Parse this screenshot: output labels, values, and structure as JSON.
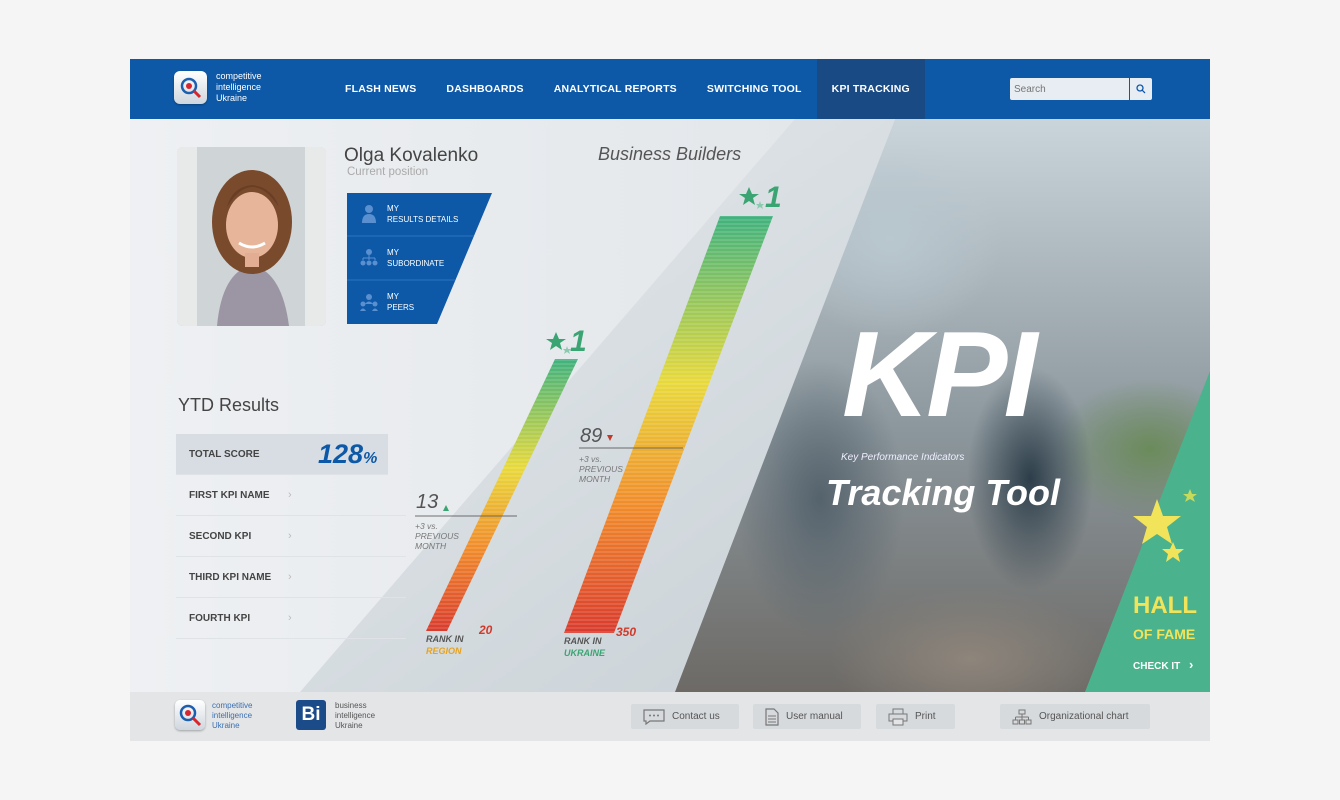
{
  "header": {
    "logo_lines": [
      "competitive",
      "intelligence",
      "Ukraine"
    ],
    "nav": [
      "FLASH NEWS",
      "DASHBOARDS",
      "ANALYTICAL REPORTS",
      "SWITCHING TOOL",
      "KPI TRACKING"
    ],
    "active_nav": "KPI TRACKING",
    "search_placeholder": "Search"
  },
  "profile": {
    "name": "Olga Kovalenko",
    "position": "Current position",
    "menu": [
      {
        "line1": "MY",
        "line2": "RESULTS DETAILS",
        "icon": "person-icon"
      },
      {
        "line1": "MY",
        "line2": "SUBORDINATE",
        "icon": "hierarchy-icon"
      },
      {
        "line1": "MY",
        "line2": "PEERS",
        "icon": "peers-icon"
      }
    ]
  },
  "business_title": "Business Builders",
  "ytd": {
    "title": "YTD Results",
    "total_label": "TOTAL SCORE",
    "total_value": "128",
    "total_unit": "%",
    "items": [
      "FIRST KPI NAME",
      "SECOND KPI",
      "THIRD KPI NAME",
      "FOURTH KPI"
    ]
  },
  "region": {
    "top_rank": "1",
    "value": "13",
    "delta": "+3 vs.",
    "delta2": "PREVIOUS",
    "delta3": "MONTH",
    "rank_label": "RANK IN",
    "rank_scope": "REGION",
    "rank_value": "20"
  },
  "ukraine": {
    "top_rank": "1",
    "value": "89",
    "delta": "+3 vs.",
    "delta2": "PREVIOUS",
    "delta3": "MONTH",
    "rank_label": "RANK IN",
    "rank_scope": "UKRAINE",
    "rank_value": "350"
  },
  "hero": {
    "kpi": "KPI",
    "kpi_sub": "Key Performance Indicators",
    "tracking": "Tracking Tool"
  },
  "hall": {
    "line1": "HALL",
    "line2": "OF FAME",
    "cta": "CHECK IT"
  },
  "footer": {
    "logo1_lines": [
      "competitive",
      "intelligence",
      "Ukraine"
    ],
    "logo2_mark": "Bi",
    "logo2_lines": [
      "business",
      "intelligence",
      "Ukraine"
    ],
    "buttons": [
      "Contact us",
      "User manual",
      "Print",
      "Organizational chart"
    ]
  },
  "colors": {
    "brand_blue": "#0d59a8",
    "accent_green": "#4ab38d",
    "hall_yellow": "#f2e45a",
    "rank_red": "#d23a2a"
  }
}
